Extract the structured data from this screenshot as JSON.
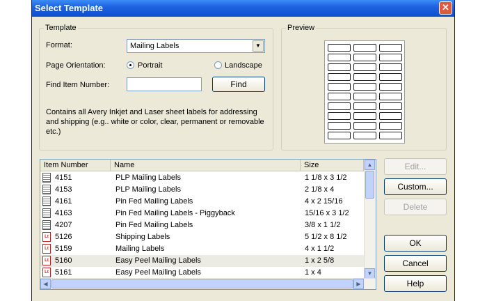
{
  "window": {
    "title": "Select Template",
    "close_glyph": "✕"
  },
  "template_group": {
    "legend": "Template",
    "format_label": "Format:",
    "format_value": "Mailing Labels",
    "orientation_label": "Page Orientation:",
    "portrait_label": "Portrait",
    "landscape_label": "Landscape",
    "orientation_selected": "Portrait",
    "find_label": "Find Item Number:",
    "find_value": "",
    "find_button": "Find",
    "description": "Contains all Avery Inkjet and Laser sheet labels for addressing and shipping (e.g.. white or color, clear, permanent or removable etc.)"
  },
  "preview_group": {
    "legend": "Preview"
  },
  "list": {
    "columns": [
      "Item Number",
      "Name",
      "Size"
    ],
    "rows": [
      {
        "icon": "document-icon",
        "item": "4151",
        "name": "PLP Mailing Labels",
        "size": "1 1/8  x 3 1/2"
      },
      {
        "icon": "document-icon",
        "item": "4153",
        "name": "PLP Mailing Labels",
        "size": "2 1/8  x 4"
      },
      {
        "icon": "document-icon",
        "item": "4161",
        "name": "Pin Fed Mailing Labels",
        "size": "4 x 2 15/16"
      },
      {
        "icon": "document-icon",
        "item": "4163",
        "name": "Pin Fed Mailing Labels - Piggyback",
        "size": "15/16 x 3 1/2"
      },
      {
        "icon": "document-icon",
        "item": "4207",
        "name": "Pin Fed Mailing Labels",
        "size": "3/8 x 1 1/2"
      },
      {
        "icon": "label-lt-icon",
        "item": "5126",
        "name": "Shipping Labels",
        "size": "5 1/2 x 8 1/2"
      },
      {
        "icon": "label-lt-icon",
        "item": "5159",
        "name": "Mailing Labels",
        "size": "4 x 1 1/2"
      },
      {
        "icon": "label-lt-icon",
        "item": "5160",
        "name": "Easy Peel Mailing Labels",
        "size": "1 x 2 5/8",
        "selected": true
      },
      {
        "icon": "label-lt-icon",
        "item": "5161",
        "name": "Easy Peel Mailing Labels",
        "size": "1 x 4"
      }
    ]
  },
  "buttons": {
    "edit": "Edit...",
    "custom": "Custom...",
    "delete": "Delete",
    "ok": "OK",
    "cancel": "Cancel",
    "help": "Help"
  },
  "icon_glyphs": {
    "lt": "Lt",
    "up": "▲",
    "down": "▼",
    "left": "◀",
    "right": "▶",
    "dropdown": "▼"
  },
  "colors": {
    "titlebar": "#0b4fd0",
    "dialog_bg": "#ece9d8",
    "field_border": "#7f9db9",
    "lt_icon": "#c02020"
  }
}
